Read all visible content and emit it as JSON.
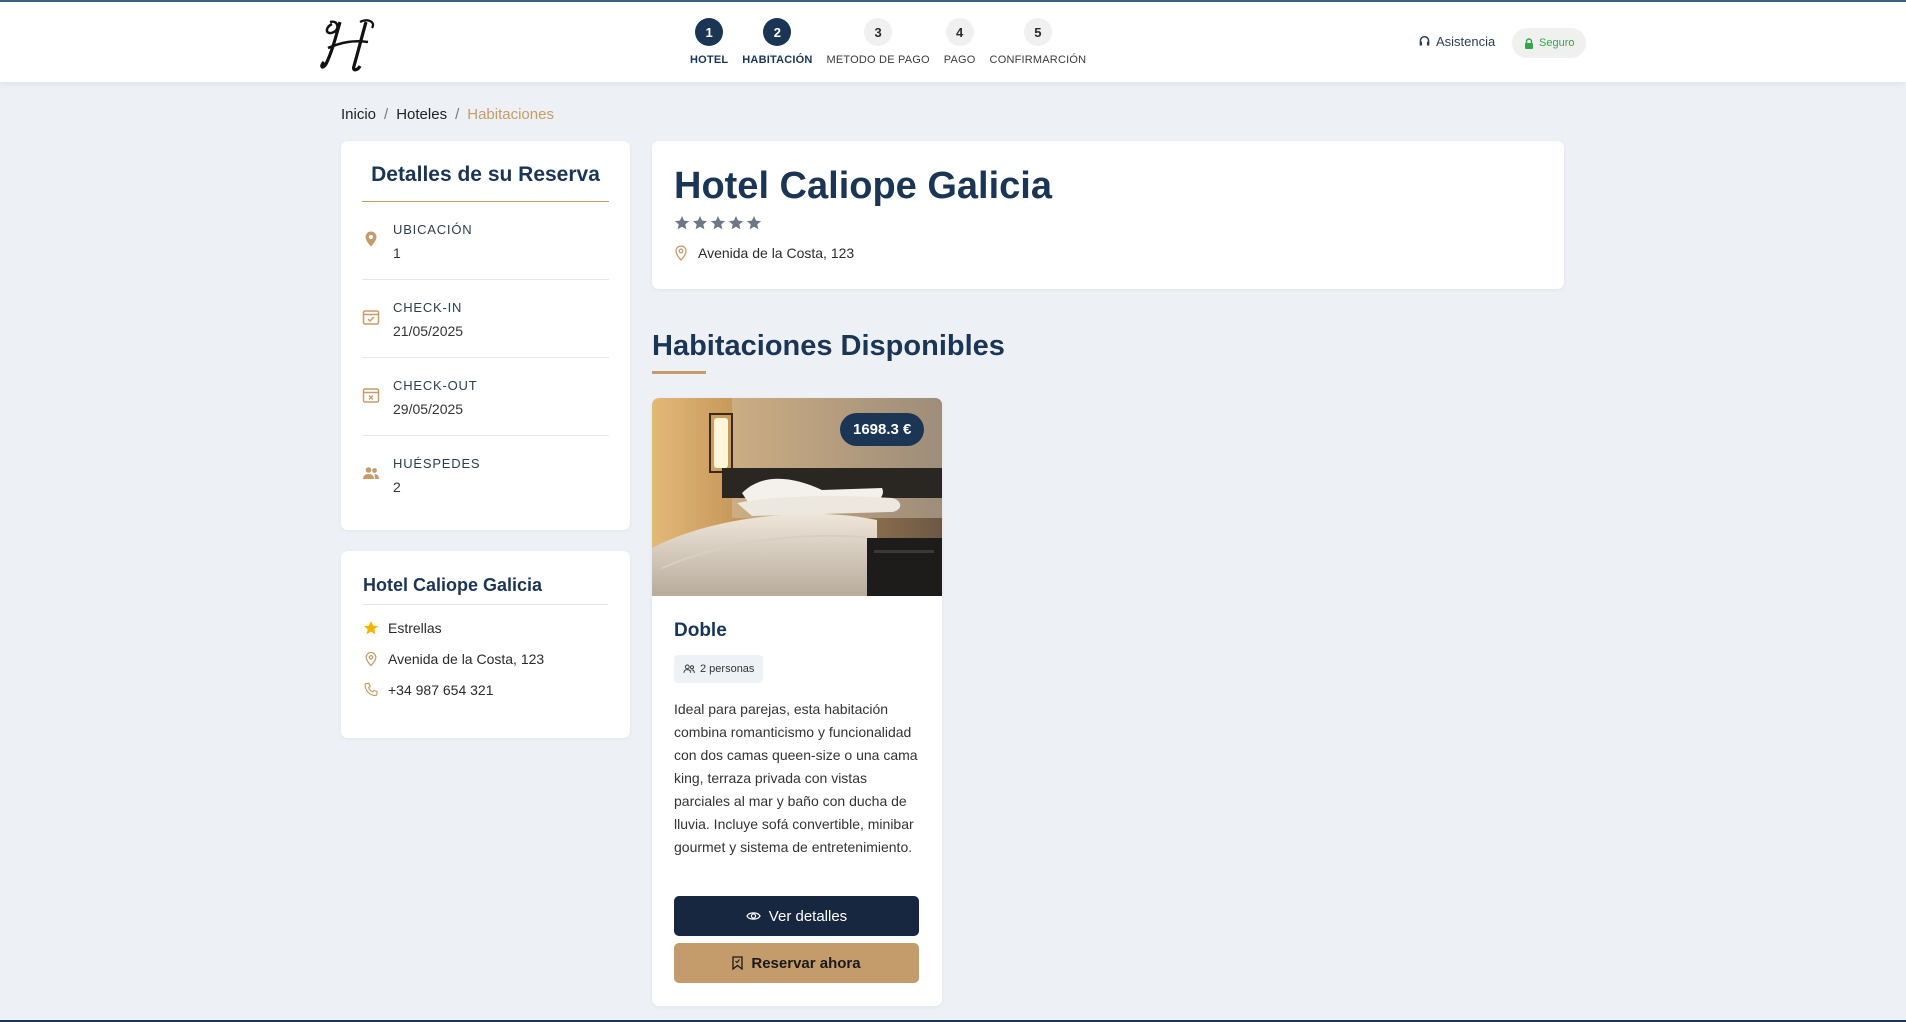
{
  "header": {
    "steps": [
      {
        "num": "1",
        "label": "HOTEL",
        "active": true
      },
      {
        "num": "2",
        "label": "HABITACIÓN",
        "active": true
      },
      {
        "num": "3",
        "label": "METODO DE PAGO",
        "active": false
      },
      {
        "num": "4",
        "label": "PAGO",
        "active": false
      },
      {
        "num": "5",
        "label": "CONFIRMARCIÓN",
        "active": false
      }
    ],
    "assist_label": "Asistencia",
    "secure_label": "Seguro"
  },
  "breadcrumb": {
    "items": [
      "Inicio",
      "Hoteles",
      "Habitaciones"
    ],
    "separator": "/"
  },
  "booking": {
    "title": "Detalles de su Reserva",
    "details": [
      {
        "key": "UBICACIÓN",
        "value": "1",
        "icon": "location-pin-icon"
      },
      {
        "key": "CHECK-IN",
        "value": "21/05/2025",
        "icon": "calendar-check-icon"
      },
      {
        "key": "CHECK-OUT",
        "value": "29/05/2025",
        "icon": "calendar-x-icon"
      },
      {
        "key": "HUÉSPEDES",
        "value": "2",
        "icon": "people-icon"
      }
    ]
  },
  "hotel_info": {
    "name": "Hotel Caliope Galicia",
    "stars_label": "Estrellas",
    "address": "Avenida de la Costa, 123",
    "phone": "+34 987 654 321"
  },
  "hotel": {
    "name": "Hotel Caliope Galicia",
    "stars": 5,
    "address": "Avenida de la Costa, 123"
  },
  "rooms_section": {
    "title": "Habitaciones Disponibles"
  },
  "room": {
    "price": "1698.3 €",
    "name": "Doble",
    "capacity": "2 personas",
    "description": "Ideal para parejas, esta habitación combina romanticismo y funcionalidad con dos camas queen-size o una cama king, terraza privada con vistas parciales al mar y baño con ducha de lluvia. Incluye sofá convertible, minibar gourmet y sistema de entretenimiento.",
    "details_button": "Ver detalles",
    "reserve_button": "Reservar ahora"
  },
  "colors": {
    "navy": "#1b3554",
    "gold": "#c49c6c",
    "background": "#edf1f6",
    "secure_green": "#3aa24a"
  }
}
